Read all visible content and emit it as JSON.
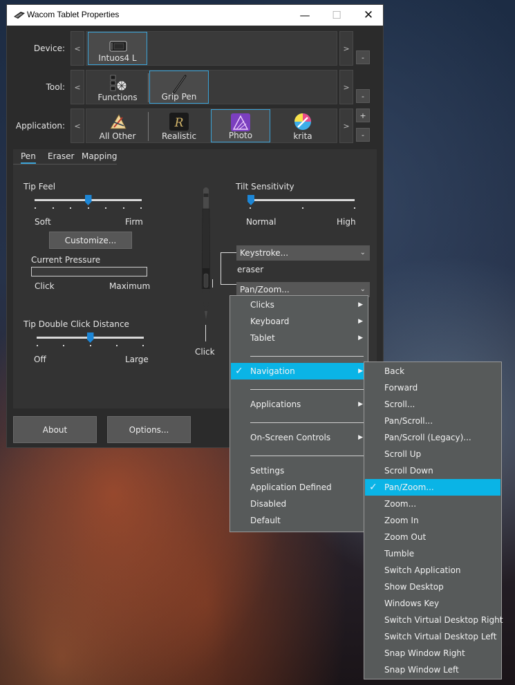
{
  "window": {
    "title": "Wacom Tablet Properties",
    "min_glyph": "—",
    "max_glyph": "☐",
    "close_glyph": "✕"
  },
  "rows": {
    "device_label": "Device:",
    "tool_label": "Tool:",
    "application_label": "Application:",
    "left_arrow": "<",
    "right_arrow": ">",
    "minus": "-",
    "plus": "+"
  },
  "device": {
    "tiles": [
      {
        "label": "Intuos4 L",
        "icon": "tablet-icon",
        "selected": true
      }
    ]
  },
  "tool": {
    "tiles": [
      {
        "label": "Functions",
        "icon": "functions-icon",
        "selected": false
      },
      {
        "label": "Grip Pen",
        "icon": "pen-icon",
        "selected": true
      }
    ]
  },
  "application": {
    "tiles": [
      {
        "label": "All Other",
        "icon": "all-other-icon",
        "selected": false
      },
      {
        "label": "Realistic",
        "icon": "realistic-icon",
        "selected": false
      },
      {
        "label": "Photo",
        "icon": "affinity-photo-icon",
        "selected": true
      },
      {
        "label": "krita",
        "icon": "krita-icon",
        "selected": false
      }
    ]
  },
  "tabs": [
    {
      "label": "Pen",
      "active": true
    },
    {
      "label": "Eraser"
    },
    {
      "label": "Mapping"
    }
  ],
  "pen": {
    "tip_feel": "Tip Feel",
    "soft": "Soft",
    "firm": "Firm",
    "tip_feel_value": 0.5,
    "customize": "Customize...",
    "current_pressure": "Current Pressure",
    "click": "Click",
    "maximum": "Maximum",
    "tip_double_click": "Tip Double Click Distance",
    "off": "Off",
    "large": "Large",
    "tip_double_click_value": 0.5,
    "tilt_sensitivity": "Tilt Sensitivity",
    "normal": "Normal",
    "high": "High",
    "tilt_value": 0.0,
    "upper_button": "Keystroke...",
    "eraser_text": "eraser",
    "lower_button": "Pan/Zoom...",
    "tip_click": "Click"
  },
  "buttons": {
    "about": "About",
    "options": "Options..."
  },
  "menu1": {
    "items": [
      {
        "label": "Clicks",
        "sub": true
      },
      {
        "label": "Keyboard",
        "sub": true
      },
      {
        "label": "Tablet",
        "sub": true
      },
      {
        "label": "Navigation",
        "sub": true,
        "checked": true,
        "highlight": true
      },
      {
        "label": "Applications",
        "sub": true
      },
      {
        "label": "On-Screen Controls",
        "sub": true
      },
      {
        "label": "Settings"
      },
      {
        "label": "Application Defined"
      },
      {
        "label": "Disabled"
      },
      {
        "label": "Default"
      }
    ]
  },
  "menu2": {
    "items": [
      {
        "label": "Back"
      },
      {
        "label": "Forward"
      },
      {
        "label": "Scroll..."
      },
      {
        "label": "Pan/Scroll..."
      },
      {
        "label": "Pan/Scroll (Legacy)..."
      },
      {
        "label": "Scroll Up"
      },
      {
        "label": "Scroll Down"
      },
      {
        "label": "Pan/Zoom...",
        "checked": true,
        "highlight": true
      },
      {
        "label": "Zoom..."
      },
      {
        "label": "Zoom In"
      },
      {
        "label": "Zoom Out"
      },
      {
        "label": "Tumble"
      },
      {
        "label": "Switch Application"
      },
      {
        "label": "Show Desktop"
      },
      {
        "label": "Windows Key"
      },
      {
        "label": "Switch Virtual Desktop Right"
      },
      {
        "label": "Switch Virtual Desktop Left"
      },
      {
        "label": "Snap Window Right"
      },
      {
        "label": "Snap Window Left"
      }
    ]
  },
  "glyphs": {
    "submenu": "▶",
    "check": "✓",
    "chevron": "⌄"
  },
  "colors": {
    "accent": "#0ab4e6",
    "thumb": "#1c86d6",
    "selection_border": "#3aa3d8"
  }
}
